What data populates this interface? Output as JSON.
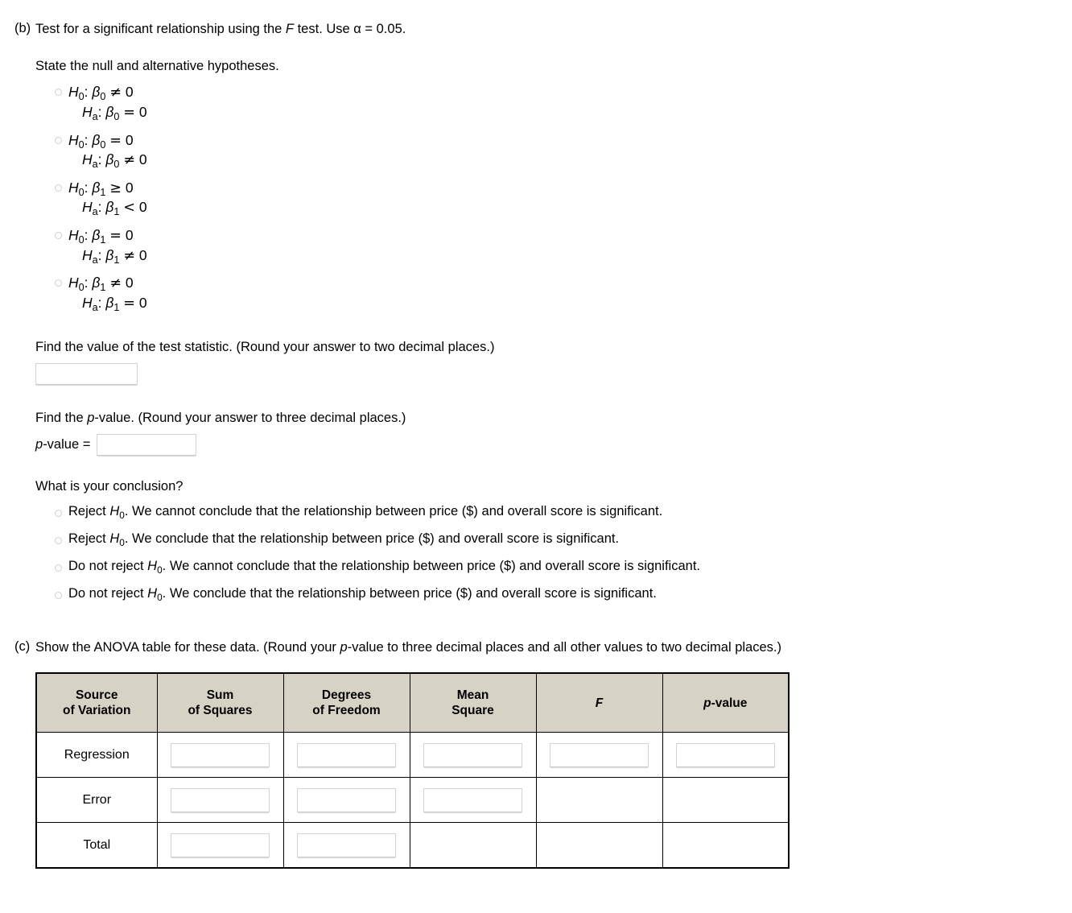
{
  "part_b": {
    "label": "(b)",
    "prompt_pre": "Test for a significant relationship using the ",
    "prompt_f": "F",
    "prompt_post": " test. Use α = 0.05.",
    "hypotheses_heading": "State the null and alternative hypotheses.",
    "hypothesis_options": [
      {
        "null": {
          "h": "H",
          "sub": "0",
          "colon": ": ",
          "beta": "β",
          "beta_sub": "0",
          "rel": "≠",
          "value": "0"
        },
        "alt": {
          "h": "H",
          "sub": "a",
          "colon": ": ",
          "beta": "β",
          "beta_sub": "0",
          "rel": "=",
          "value": "0"
        }
      },
      {
        "null": {
          "h": "H",
          "sub": "0",
          "colon": ": ",
          "beta": "β",
          "beta_sub": "0",
          "rel": "=",
          "value": "0"
        },
        "alt": {
          "h": "H",
          "sub": "a",
          "colon": ": ",
          "beta": "β",
          "beta_sub": "0",
          "rel": "≠",
          "value": "0"
        }
      },
      {
        "null": {
          "h": "H",
          "sub": "0",
          "colon": ": ",
          "beta": "β",
          "beta_sub": "1",
          "rel": "≥",
          "value": "0"
        },
        "alt": {
          "h": "H",
          "sub": "a",
          "colon": ": ",
          "beta": "β",
          "beta_sub": "1",
          "rel": "<",
          "value": "0"
        }
      },
      {
        "null": {
          "h": "H",
          "sub": "0",
          "colon": ": ",
          "beta": "β",
          "beta_sub": "1",
          "rel": "=",
          "value": "0"
        },
        "alt": {
          "h": "H",
          "sub": "a",
          "colon": ": ",
          "beta": "β",
          "beta_sub": "1",
          "rel": "≠",
          "value": "0"
        }
      },
      {
        "null": {
          "h": "H",
          "sub": "0",
          "colon": ": ",
          "beta": "β",
          "beta_sub": "1",
          "rel": "≠",
          "value": "0"
        },
        "alt": {
          "h": "H",
          "sub": "a",
          "colon": ": ",
          "beta": "β",
          "beta_sub": "1",
          "rel": "=",
          "value": "0"
        }
      }
    ],
    "test_statistic_prompt": "Find the value of the test statistic. (Round your answer to two decimal places.)",
    "test_statistic_value": "",
    "pvalue_prompt_pre": "Find the ",
    "pvalue_prompt_p": "p",
    "pvalue_prompt_post": "-value. (Round your answer to three decimal places.)",
    "pvalue_label_p": "p",
    "pvalue_label_rest": "-value =",
    "pvalue_value": "",
    "conclusion_heading": "What is your conclusion?",
    "conclusion_options": [
      {
        "pre": "Reject ",
        "h": "H",
        "sub": "0",
        "post": ". We cannot conclude that the relationship between price ($) and overall score is significant."
      },
      {
        "pre": "Reject ",
        "h": "H",
        "sub": "0",
        "post": ". We conclude that the relationship between price ($) and overall score is significant."
      },
      {
        "pre": "Do not reject ",
        "h": "H",
        "sub": "0",
        "post": ". We cannot conclude that the relationship between price ($) and overall score is significant."
      },
      {
        "pre": "Do not reject ",
        "h": "H",
        "sub": "0",
        "post": ". We conclude that the relationship between price ($) and overall score is significant."
      }
    ]
  },
  "part_c": {
    "label": "(c)",
    "prompt_pre": "Show the ANOVA table for these data. (Round your ",
    "prompt_p": "p",
    "prompt_post": "-value to three decimal places and all other values to two decimal places.)",
    "table": {
      "header_bg": "#d6d2c4",
      "columns": [
        {
          "line1": "Source",
          "line2": "of Variation"
        },
        {
          "line1": "Sum",
          "line2": "of Squares"
        },
        {
          "line1": "Degrees",
          "line2": "of Freedom"
        },
        {
          "line1": "Mean",
          "line2": "Square"
        },
        {
          "line1": "F",
          "line2": "",
          "italic": true
        },
        {
          "line1": "p-value",
          "line2": "",
          "italic_p": true
        }
      ],
      "rows": [
        {
          "label": "Regression",
          "inputs": [
            true,
            true,
            true,
            true,
            true
          ],
          "values": [
            "",
            "",
            "",
            "",
            ""
          ]
        },
        {
          "label": "Error",
          "inputs": [
            true,
            true,
            true,
            false,
            false
          ],
          "values": [
            "",
            "",
            "",
            "",
            ""
          ]
        },
        {
          "label": "Total",
          "inputs": [
            true,
            true,
            false,
            false,
            false
          ],
          "values": [
            "",
            "",
            "",
            "",
            ""
          ]
        }
      ]
    }
  }
}
